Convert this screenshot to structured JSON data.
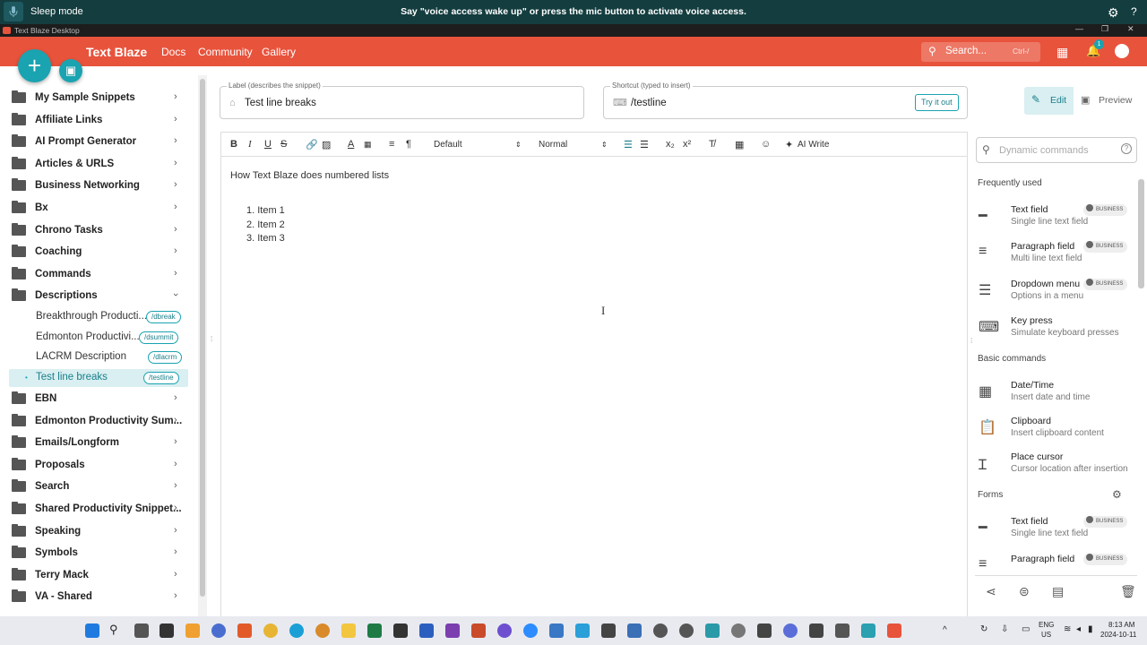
{
  "voice": {
    "status": "Sleep mode",
    "message": "Say \"voice access wake up\" or press the mic button to activate voice access."
  },
  "window": {
    "title": "Text Blaze Desktop"
  },
  "appbar": {
    "brand": "Text Blaze",
    "nav": [
      "Docs",
      "Community",
      "Gallery"
    ],
    "search_placeholder": "Search...",
    "search_shortcut": "Ctrl-/",
    "notif_count": "1"
  },
  "sidebar": {
    "folders_top": [
      "My Sample Snippets",
      "Affiliate Links",
      "AI Prompt Generator",
      "Articles & URLS",
      "Business Networking",
      "Bx",
      "Chrono Tasks",
      "Coaching",
      "Commands",
      "Descriptions"
    ],
    "snippets": [
      {
        "name": "Breakthrough Producti...",
        "shortcut": "/dbreak"
      },
      {
        "name": "Edmonton Productivi...",
        "shortcut": "/dsummit"
      },
      {
        "name": "LACRM Description",
        "shortcut": "/dlacrm"
      },
      {
        "name": "Test line breaks",
        "shortcut": "/testline"
      }
    ],
    "folders_bottom": [
      "EBN",
      "Edmonton Productivity Sum...",
      "Emails/Longform",
      "Proposals",
      "Search",
      "Shared Productivity Snippet...",
      "Speaking",
      "Symbols",
      "Terry Mack",
      "VA - Shared"
    ]
  },
  "snippet": {
    "label_caption": "Label (describes the snippet)",
    "label_value": "Test line breaks",
    "shortcut_caption": "Shortcut (typed to insert)",
    "shortcut_value": "/testline",
    "try_label": "Try it out"
  },
  "modes": {
    "edit": "Edit",
    "preview": "Preview"
  },
  "toolbar": {
    "font": "Default",
    "size": "Normal",
    "ai_write": "AI Write"
  },
  "content": {
    "heading": "How Text Blaze does numbered lists",
    "items": [
      "Item 1",
      "Item 2",
      "Item 3"
    ]
  },
  "rpanel": {
    "search_placeholder": "Dynamic commands",
    "badge": "BUSINESS",
    "sections": {
      "frequent": "Frequently used",
      "basic": "Basic commands",
      "forms": "Forms"
    },
    "frequent": [
      {
        "title": "Text field",
        "sub": "Single line text field",
        "icon": "text-field-icon"
      },
      {
        "title": "Paragraph field",
        "sub": "Multi line text field",
        "icon": "paragraph-icon"
      },
      {
        "title": "Dropdown menu",
        "sub": "Options in a menu",
        "icon": "dropdown-icon"
      },
      {
        "title": "Key press",
        "sub": "Simulate keyboard presses",
        "icon": "keyboard-icon"
      }
    ],
    "basic": [
      {
        "title": "Date/Time",
        "sub": "Insert date and time",
        "icon": "calendar-icon"
      },
      {
        "title": "Clipboard",
        "sub": "Insert clipboard content",
        "icon": "clipboard-icon"
      },
      {
        "title": "Place cursor",
        "sub": "Cursor location after insertion",
        "icon": "cursor-icon"
      }
    ],
    "forms": [
      {
        "title": "Text field",
        "sub": "Single line text field",
        "icon": "text-field-icon"
      },
      {
        "title": "Paragraph field",
        "sub": "",
        "icon": "paragraph-icon"
      }
    ]
  },
  "taskbar": {
    "lang1": "ENG",
    "lang2": "US",
    "time": "8:13 AM",
    "date": "2024-10-11"
  },
  "colors": {
    "brand": "#e8533c",
    "accent": "#1aa3b0",
    "voicebar": "#143d3f"
  }
}
